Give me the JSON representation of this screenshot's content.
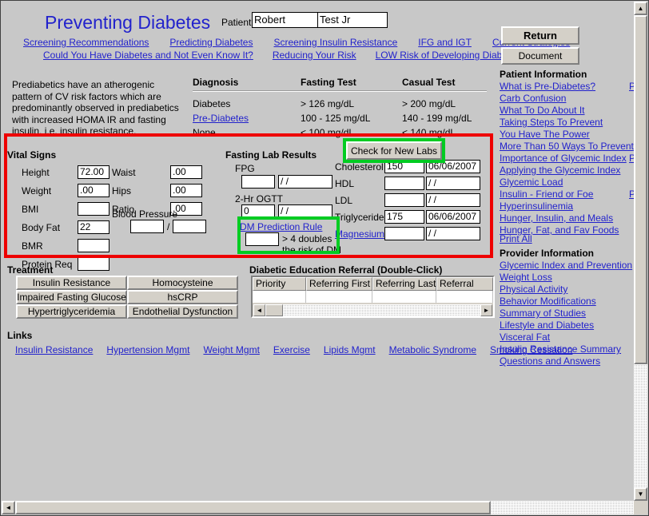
{
  "window": {
    "title": "Preventing Diabetes",
    "background_color": "#c8c8c8",
    "link_color": "#2222cc"
  },
  "header": {
    "title": "Preventing Diabetes",
    "patient_label": "Patient",
    "patient_first_value": "Robert",
    "patient_last_value": "Test Jr"
  },
  "nav_links_row1": [
    "Screening Recommendations",
    "Predicting Diabetes",
    "Screening Insulin Resistance",
    "IFG and IGT",
    "Current Strategies"
  ],
  "nav_links_row2": [
    "Could You Have Diabetes and Not Even Know It?",
    "Reducing Your Risk",
    "LOW Risk of Developing Diabetes"
  ],
  "intro": {
    "paragraph": "Prediabetics  have an atherogenic pattern of CV risk factors which are predominantly observed in prediabetics with increased HOMA IR and fasting insulin, i.e. insulin resistance."
  },
  "diagnosis_table": {
    "headers": [
      "Diagnosis",
      "Fasting Test",
      "Casual Test"
    ],
    "rows": [
      {
        "diagnosis": "Diabetes",
        "is_link": false,
        "fasting": "> 126 mg/dL",
        "casual": "> 200 mg/dL"
      },
      {
        "diagnosis": "Pre-Diabetes",
        "is_link": true,
        "fasting": "100 - 125 mg/dL",
        "casual": "140 - 199 mg/dL"
      },
      {
        "diagnosis": "None",
        "is_link": false,
        "fasting": "< 100 mg/dL",
        "casual": "< 140 mg/dL"
      }
    ]
  },
  "vital_signs": {
    "heading": "Vital Signs",
    "column1": [
      {
        "label": "Height",
        "value": "72.00"
      },
      {
        "label": "Weight",
        "value": ".00"
      },
      {
        "label": "BMI",
        "value": ""
      },
      {
        "label": "Body Fat",
        "value": "22"
      },
      {
        "label": "BMR",
        "value": ""
      },
      {
        "label": "Protein Req",
        "value": ""
      }
    ],
    "column2": [
      {
        "label": "Waist",
        "value": ".00"
      },
      {
        "label": "Hips",
        "value": ".00"
      },
      {
        "label": "Ratio",
        "value": ".00"
      }
    ],
    "blood_pressure": {
      "label": "Blood Pressure",
      "systolic": "",
      "diastolic": "",
      "separator": "/"
    }
  },
  "fasting_labs": {
    "heading": "Fasting Lab Results",
    "check_new_labs_button": "Check for New Labs",
    "fpg": {
      "label": "FPG",
      "value": "",
      "date": "  /  /"
    },
    "ogtt": {
      "label": "2-Hr OGTT",
      "value": "0",
      "date": "  /  /"
    },
    "dm_prediction": {
      "link": "DM Prediction Rule",
      "value": "",
      "note_line1": "> 4 doubles",
      "note_line2": "the risk of DM"
    },
    "panel": [
      {
        "name": "Cholesterol",
        "is_link": false,
        "value": "150",
        "date": "06/06/2007"
      },
      {
        "name": "HDL",
        "is_link": false,
        "value": "",
        "date": "  /  /"
      },
      {
        "name": "LDL",
        "is_link": false,
        "value": "",
        "date": "  /  /"
      },
      {
        "name": "Triglycerides",
        "is_link": false,
        "value": "175",
        "date": "06/06/2007"
      },
      {
        "name": "Magnesium",
        "is_link": true,
        "value": "",
        "date": "  /  /"
      }
    ]
  },
  "treatment": {
    "heading": "Treatment",
    "buttons": [
      [
        "Insulin Resistance",
        "Homocysteine"
      ],
      [
        "Impaired Fasting Glucose",
        "hsCRP"
      ],
      [
        "Hypertriglyceridemia",
        "Endothelial Dysfunction"
      ]
    ]
  },
  "referral": {
    "heading": "Diabetic Education Referral (Double-Click)",
    "columns": [
      "Priority",
      "Referring First",
      "Referring Last",
      "Referral"
    ],
    "rows": [
      {
        "priority": "",
        "referring_first": "",
        "referring_last": "",
        "referral": ""
      }
    ]
  },
  "links_section": {
    "heading": "Links",
    "items": [
      "Insulin Resistance",
      "Hypertension Mgmt",
      "Weight Mgmt",
      "Exercise",
      "Lipids Mgmt",
      "Metabolic Syndrome",
      "Smoking Cessation"
    ]
  },
  "sidebar": {
    "return_button": "Return",
    "document_button": "Document",
    "patient_information_heading": "Patient Information",
    "patient_information_links": [
      "What is Pre-Diabetes?",
      "Carb Confusion",
      "What To Do About It",
      "Taking Steps To Prevent",
      "You Have The Power",
      "More Than 50 Ways To Prevent",
      "Importance of Glycemic Index",
      "Applying the Glycemic Index",
      "Glycemic Load",
      "Insulin - Friend or Foe",
      "Hyperinsulinemia",
      "Hunger, Insulin, and Meals",
      "Hunger, Fat, and Fav Foods"
    ],
    "print_all": "Print All",
    "provider_information_heading": "Provider Information",
    "provider_information_links": [
      "Glycemic Index and Prevention",
      "Weight Loss",
      "Physical Activity",
      "Behavior Modifications",
      "Summary of Studies",
      "Lifestyle and Diabetes",
      "Visceral Fat",
      "Insulin Resistance Summary",
      "Questions and Answers"
    ],
    "clipped_print_links": [
      "Pr",
      "Pr",
      "Pr"
    ]
  },
  "annotations": {
    "red_box_color": "#ee0000",
    "green_box_color": "#00cc22"
  },
  "scrollbars": {
    "up_arrow": "▲",
    "down_arrow": "▼",
    "left_arrow": "◄",
    "right_arrow": "►"
  }
}
